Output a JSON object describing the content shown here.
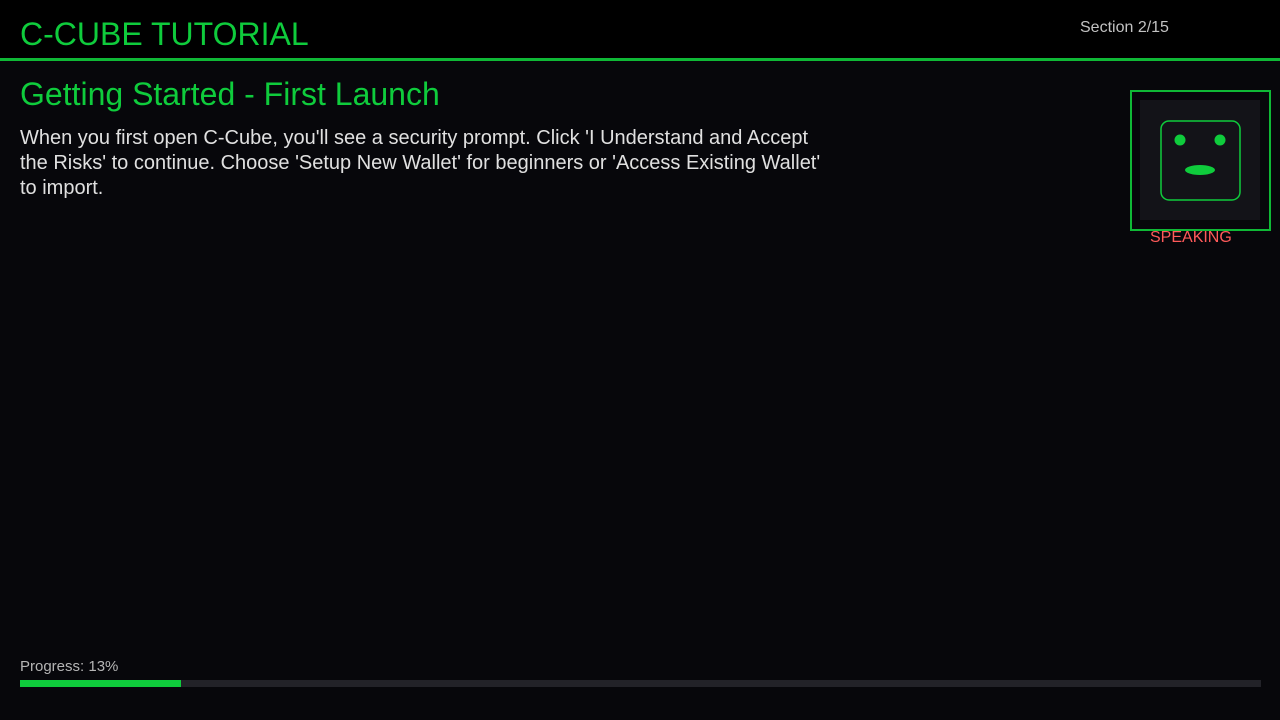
{
  "header": {
    "title": "C-CUBE TUTORIAL",
    "section_counter": "Section 2/15"
  },
  "content": {
    "heading": "Getting Started - First Launch",
    "body": "When you first open C-Cube, you'll see a security prompt. Click 'I Understand and Accept the Risks' to continue. Choose 'Setup New Wallet' for beginners or 'Access Existing Wallet' to import."
  },
  "avatar": {
    "icon": "robot-face-icon",
    "status": "SPEAKING"
  },
  "progress": {
    "label": "Progress: 13%",
    "percent": 13
  },
  "colors": {
    "accent": "#0fcc3c",
    "background": "#07070b",
    "header_background": "#000000",
    "body_text": "#e0e0e0",
    "status_text": "#ff5a5a"
  }
}
